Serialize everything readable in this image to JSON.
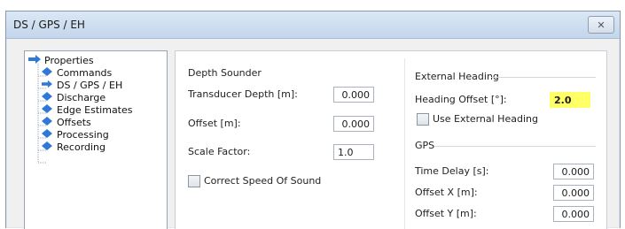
{
  "window": {
    "title": "DS / GPS / EH",
    "close_glyph": "✕"
  },
  "tree": {
    "root": "Properties",
    "items": [
      "Commands",
      "DS / GPS / EH",
      "Discharge",
      "Edge Estimates",
      "Offsets",
      "Processing",
      "Recording"
    ]
  },
  "depth_sounder": {
    "title": "Depth Sounder",
    "transducer_depth_label": "Transducer Depth [m]:",
    "transducer_depth_value": "0.000",
    "offset_label": "Offset [m]:",
    "offset_value": "0.000",
    "scale_factor_label": "Scale Factor:",
    "scale_factor_value": "1.0",
    "correct_sos_label": "Correct Speed Of Sound"
  },
  "external_heading": {
    "title": "External Heading",
    "heading_offset_label": "Heading Offset [°]:",
    "heading_offset_value": "2.0",
    "use_external_label": "Use External Heading",
    "highlight_color": "#ffff66"
  },
  "gps": {
    "title": "GPS",
    "time_delay_label": "Time Delay [s]:",
    "time_delay_value": "0.000",
    "offset_x_label": "Offset X [m]:",
    "offset_x_value": "0.000",
    "offset_y_label": "Offset Y [m]:",
    "offset_y_value": "0.000"
  }
}
